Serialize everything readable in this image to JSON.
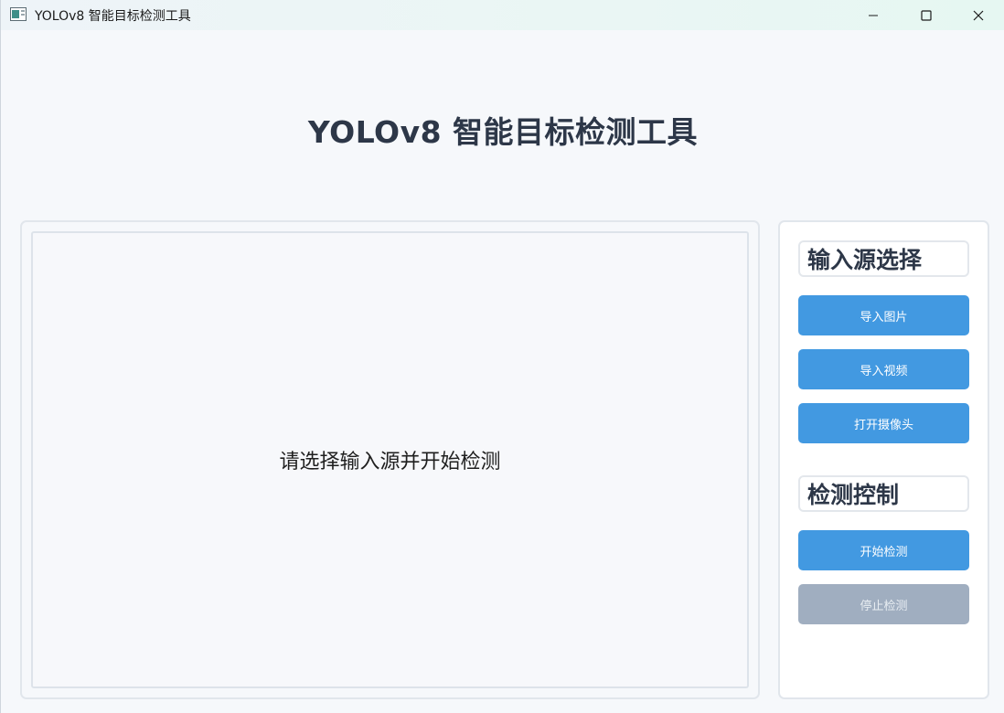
{
  "window": {
    "title": "YOLOv8 智能目标检测工具",
    "icon": "app-window-icon",
    "controls": {
      "minimize_icon": "minimize-icon",
      "maximize_icon": "maximize-icon",
      "close_icon": "close-icon"
    }
  },
  "header": {
    "title": "YOLOv8 智能目标检测工具"
  },
  "preview": {
    "placeholder": "请选择输入源并开始检测"
  },
  "input_source": {
    "label": "输入源选择",
    "buttons": {
      "import_image": "导入图片",
      "import_video": "导入视频",
      "open_camera": "打开摄像头"
    }
  },
  "detection_control": {
    "label": "检测控制",
    "buttons": {
      "start": "开始检测",
      "stop": "停止检测"
    },
    "stop_enabled": false
  },
  "colors": {
    "accent": "#4299e1",
    "disabled": "#a0aec0",
    "heading": "#2d3748",
    "background": "#f6f8fb"
  }
}
